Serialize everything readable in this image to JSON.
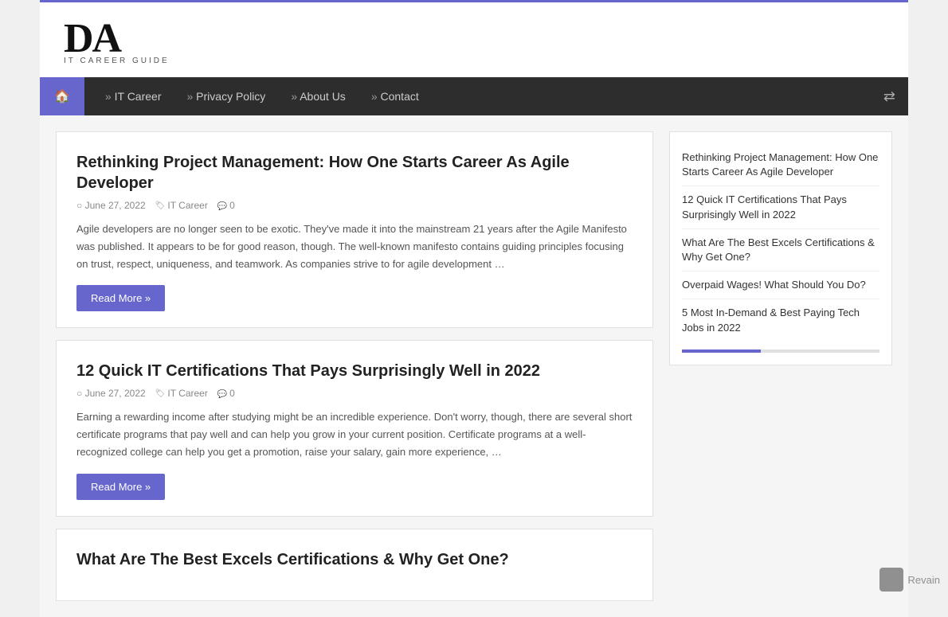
{
  "site": {
    "logo_main": "DA",
    "logo_sub": "IT CAREER GUIDE",
    "border_color": "#6666cc"
  },
  "nav": {
    "home_label": "🏠",
    "links": [
      {
        "label": "IT Career",
        "href": "#"
      },
      {
        "label": "Privacy Policy",
        "href": "#"
      },
      {
        "label": "About Us",
        "href": "#"
      },
      {
        "label": "Contact",
        "href": "#"
      }
    ],
    "random_icon": "⇄"
  },
  "posts": [
    {
      "id": "post-1",
      "title": "Rethinking Project Management: How One Starts Career As Agile Developer",
      "date": "June 27, 2022",
      "category": "IT Career",
      "comments": "0",
      "excerpt": "Agile developers are no longer seen to be exotic. They've made it into the mainstream 21 years after the Agile Manifesto was published. It appears to be for good reason, though. The well-known manifesto contains guiding principles focusing on trust, respect, uniqueness, and teamwork. As companies strive to for agile development …",
      "read_more": "Read More »"
    },
    {
      "id": "post-2",
      "title": "12 Quick IT Certifications That Pays Surprisingly Well in 2022",
      "date": "June 27, 2022",
      "category": "IT Career",
      "comments": "0",
      "excerpt": "Earning a rewarding income after studying might be an incredible experience. Don't worry, though, there are several short certificate programs that pay well and can help you grow in your current position. Certificate programs at a well-recognized college can help you get a promotion, raise your salary, gain more experience, …",
      "read_more": "Read More »"
    },
    {
      "id": "post-3",
      "title": "What Are The Best Excels Certifications & Why Get One?",
      "date": "",
      "category": "",
      "comments": "",
      "excerpt": "",
      "read_more": ""
    }
  ],
  "sidebar": {
    "links": [
      "Rethinking Project Management: How One Starts Career As Agile Developer",
      "12 Quick IT Certifications That Pays Surprisingly Well in 2022",
      "What Are The Best Excels Certifications & Why Get One?",
      "Overpaid Wages! What Should You Do?",
      "5 Most In-Demand & Best Paying Tech Jobs in 2022"
    ]
  },
  "revain": {
    "text": "Revain"
  }
}
